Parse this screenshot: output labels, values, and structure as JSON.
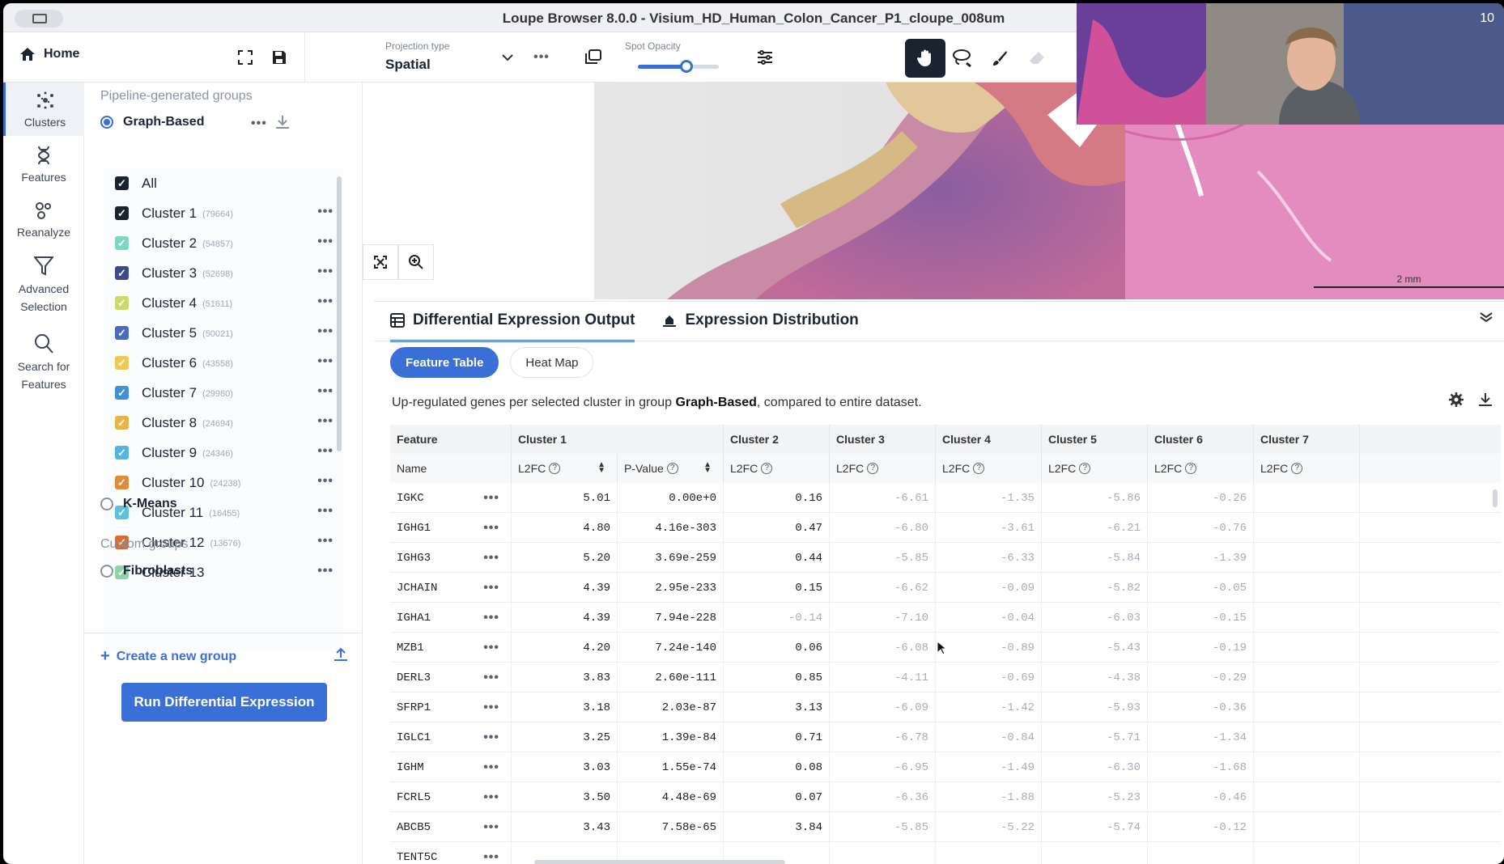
{
  "window": {
    "title": "Loupe Browser 8.0.0 - Visium_HD_Human_Colon_Cancer_P1_cloupe_008um"
  },
  "toolbar": {
    "home_label": "Home",
    "projection_label": "Projection type",
    "projection_value": "Spatial",
    "opacity_label": "Spot Opacity",
    "opacity_level": 0.6
  },
  "rail": [
    {
      "label": "Clusters",
      "icon": "clusters-icon"
    },
    {
      "label": "Features",
      "icon": "features-icon"
    },
    {
      "label": "Reanalyze",
      "icon": "reanalyze-icon"
    },
    {
      "label": "Advanced Selection",
      "icon": "filter-icon"
    },
    {
      "label": "Search for Features",
      "icon": "search-icon"
    }
  ],
  "groups": {
    "pipeline_label": "Pipeline-generated groups",
    "graph_based": "Graph-Based",
    "all_label": "All",
    "clusters": [
      {
        "name": "Cluster 1",
        "count": "(79664)",
        "color": "#1b2230"
      },
      {
        "name": "Cluster 2",
        "count": "(54857)",
        "color": "#7fd4c2"
      },
      {
        "name": "Cluster 3",
        "count": "(52698)",
        "color": "#3a4a8c"
      },
      {
        "name": "Cluster 4",
        "count": "(51611)",
        "color": "#c9dc6a"
      },
      {
        "name": "Cluster 5",
        "count": "(50021)",
        "color": "#4a6bc4"
      },
      {
        "name": "Cluster 6",
        "count": "(43558)",
        "color": "#f0c85a"
      },
      {
        "name": "Cluster 7",
        "count": "(29980)",
        "color": "#3f8fd9"
      },
      {
        "name": "Cluster 8",
        "count": "(24694)",
        "color": "#e8b445"
      },
      {
        "name": "Cluster 9",
        "count": "(24346)",
        "color": "#52b4e0"
      },
      {
        "name": "Cluster 10",
        "count": "(24238)",
        "color": "#e08a3c"
      },
      {
        "name": "Cluster 11",
        "count": "(16455)",
        "color": "#5cc1dc"
      },
      {
        "name": "Cluster 12",
        "count": "(13676)",
        "color": "#d96b2f"
      },
      {
        "name": "Cluster 13",
        "count": "",
        "color": "#8fd3a8"
      }
    ],
    "kmeans": "K-Means",
    "custom_label": "Custom groups",
    "fibroblasts": "Fibroblasts",
    "create_label": "Create a new group",
    "run_label": "Run Differential Expression"
  },
  "scalebar": "2 mm",
  "cam_timer": "10",
  "de": {
    "tab1": "Differential Expression Output",
    "tab2": "Expression Distribution",
    "pill1": "Feature Table",
    "pill2": "Heat Map",
    "desc_pre": "Up-regulated genes per selected cluster in group ",
    "desc_group": "Graph-Based",
    "desc_post": ", compared to entire dataset.",
    "head_feature": "Feature",
    "head_name": "Name",
    "clusters": [
      "Cluster 1",
      "Cluster 2",
      "Cluster 3",
      "Cluster 4",
      "Cluster 5",
      "Cluster 6",
      "Cluster 7"
    ],
    "l2fc": "L2FC",
    "pvalue": "P-Value",
    "rows": [
      {
        "name": "IGKC",
        "c1": "5.01",
        "p": "0.00e+0",
        "c2": "0.16",
        "c3": "-6.61",
        "c4": "-1.35",
        "c5": "-5.86",
        "c6": "-0.26"
      },
      {
        "name": "IGHG1",
        "c1": "4.80",
        "p": "4.16e-303",
        "c2": "0.47",
        "c3": "-6.80",
        "c4": "-3.61",
        "c5": "-6.21",
        "c6": "-0.76"
      },
      {
        "name": "IGHG3",
        "c1": "5.20",
        "p": "3.69e-259",
        "c2": "0.44",
        "c3": "-5.85",
        "c4": "-6.33",
        "c5": "-5.84",
        "c6": "-1.39"
      },
      {
        "name": "JCHAIN",
        "c1": "4.39",
        "p": "2.95e-233",
        "c2": "0.15",
        "c3": "-6.62",
        "c4": "-0.09",
        "c5": "-5.82",
        "c6": "-0.05"
      },
      {
        "name": "IGHA1",
        "c1": "4.39",
        "p": "7.94e-228",
        "c2": "-0.14",
        "c3": "-7.10",
        "c4": "-0.04",
        "c5": "-6.03",
        "c6": "-0.15"
      },
      {
        "name": "MZB1",
        "c1": "4.20",
        "p": "7.24e-140",
        "c2": "0.06",
        "c3": "-6.08",
        "c4": "-0.89",
        "c5": "-5.43",
        "c6": "-0.19"
      },
      {
        "name": "DERL3",
        "c1": "3.83",
        "p": "2.60e-111",
        "c2": "0.85",
        "c3": "-4.11",
        "c4": "-0.69",
        "c5": "-4.38",
        "c6": "-0.29"
      },
      {
        "name": "SFRP1",
        "c1": "3.18",
        "p": "2.03e-87",
        "c2": "3.13",
        "c3": "-6.09",
        "c4": "-1.42",
        "c5": "-5.93",
        "c6": "-0.36"
      },
      {
        "name": "IGLC1",
        "c1": "3.25",
        "p": "1.39e-84",
        "c2": "0.71",
        "c3": "-6.78",
        "c4": "-0.84",
        "c5": "-5.71",
        "c6": "-1.34"
      },
      {
        "name": "IGHM",
        "c1": "3.03",
        "p": "1.55e-74",
        "c2": "0.08",
        "c3": "-6.95",
        "c4": "-1.49",
        "c5": "-6.30",
        "c6": "-1.68"
      },
      {
        "name": "FCRL5",
        "c1": "3.50",
        "p": "4.48e-69",
        "c2": "0.07",
        "c3": "-6.36",
        "c4": "-1.88",
        "c5": "-5.23",
        "c6": "-0.46"
      },
      {
        "name": "ABCB5",
        "c1": "3.43",
        "p": "7.58e-65",
        "c2": "3.84",
        "c3": "-5.85",
        "c4": "-5.22",
        "c5": "-5.74",
        "c6": "-0.12"
      },
      {
        "name": "TENT5C",
        "c1": "",
        "p": "",
        "c2": "",
        "c3": "",
        "c4": "",
        "c5": "",
        "c6": ""
      }
    ]
  }
}
